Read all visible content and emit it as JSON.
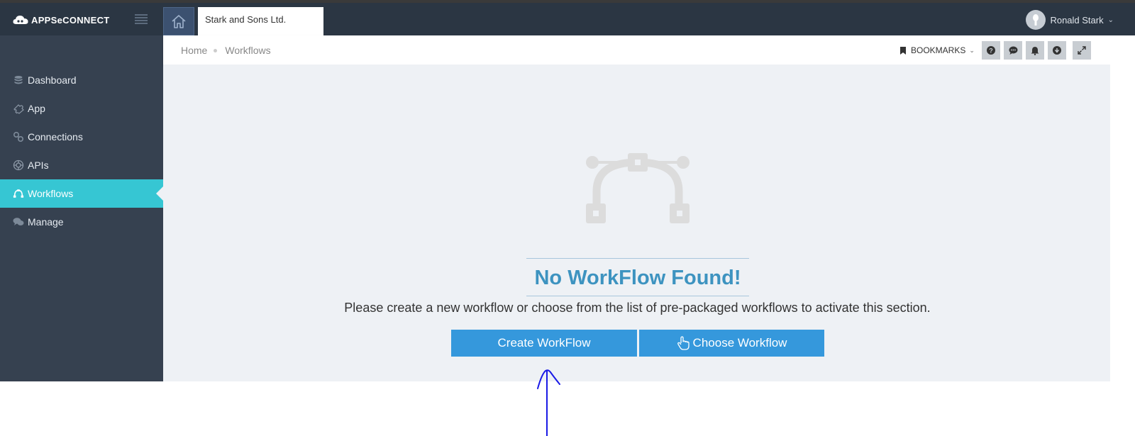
{
  "app": {
    "logo_text": "APPSeCONNECT",
    "company_tab": "Stark and Sons Ltd.",
    "user_name": "Ronald Stark"
  },
  "sidebar": {
    "items": [
      {
        "label": "Dashboard",
        "icon": "database-icon"
      },
      {
        "label": "App",
        "icon": "puzzle-icon"
      },
      {
        "label": "Connections",
        "icon": "link-icon"
      },
      {
        "label": "APIs",
        "icon": "gear-icon"
      },
      {
        "label": "Workflows",
        "icon": "curve-icon",
        "active": true
      },
      {
        "label": "Manage",
        "icon": "chat-icon"
      }
    ]
  },
  "breadcrumb": {
    "items": [
      "Home",
      "Workflows"
    ]
  },
  "toolbar": {
    "bookmarks_label": "BOOKMARKS",
    "buttons": [
      "help-icon",
      "comment-icon",
      "bell-icon",
      "download-icon",
      "expand-icon"
    ]
  },
  "main": {
    "empty_title": "No WorkFlow Found!",
    "empty_description": "Please create a new workflow or choose from the list of pre-packaged workflows to activate this section.",
    "create_button": "Create WorkFlow",
    "choose_button": "Choose Workflow"
  },
  "colors": {
    "topbar": "#2b3643",
    "sidebar": "#364150",
    "active": "#36c6d3",
    "primary_button": "#3598dc",
    "title": "#3d93c0",
    "annotation": "#1a1ae6"
  }
}
